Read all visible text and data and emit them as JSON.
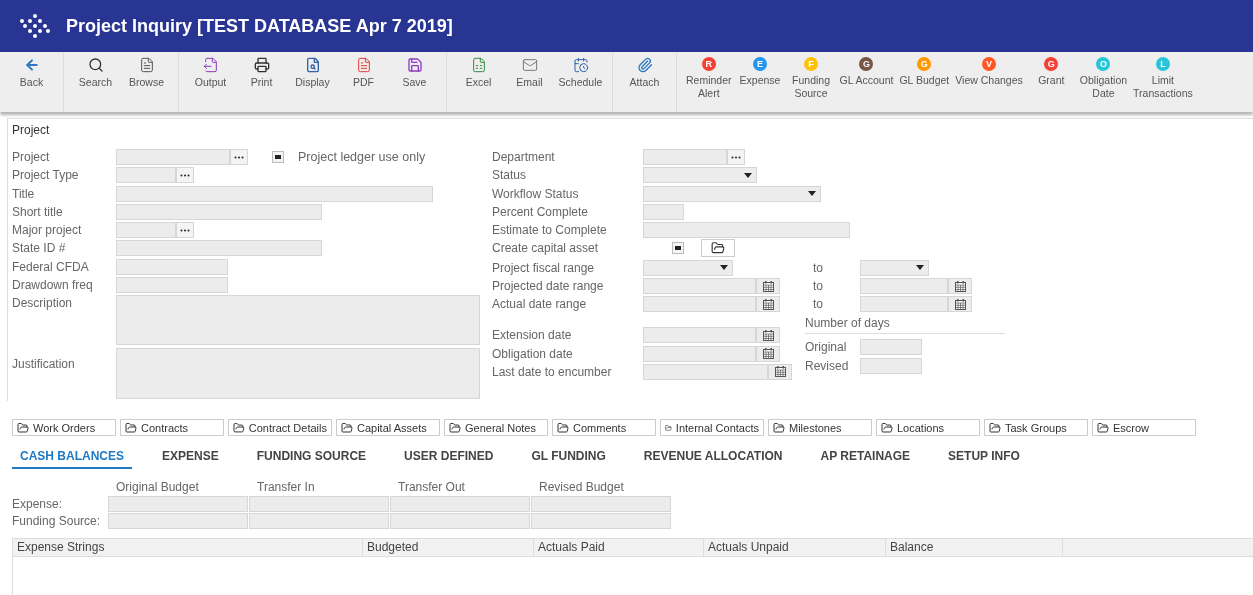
{
  "window": {
    "title": "Project Inquiry [TEST DATABASE Apr 7 2019]"
  },
  "toolbar": {
    "groups": [
      [
        {
          "kind": "icon",
          "label": "Back"
        }
      ],
      [
        {
          "kind": "icon",
          "label": "Search"
        },
        {
          "kind": "icon",
          "label": "Browse"
        }
      ],
      [
        {
          "kind": "icon",
          "label": "Output"
        },
        {
          "kind": "icon",
          "label": "Print"
        },
        {
          "kind": "icon",
          "label": "Display"
        },
        {
          "kind": "icon",
          "label": "PDF"
        },
        {
          "kind": "icon",
          "label": "Save"
        }
      ],
      [
        {
          "kind": "icon",
          "label": "Excel"
        },
        {
          "kind": "icon",
          "label": "Email"
        },
        {
          "kind": "icon",
          "label": "Schedule"
        }
      ],
      [
        {
          "kind": "icon",
          "label": "Attach"
        }
      ],
      [
        {
          "kind": "badge",
          "badge": "R",
          "color": "#f44336",
          "label": "Reminder\nAlert"
        },
        {
          "kind": "badge",
          "badge": "E",
          "color": "#2196f3",
          "label": "Expense"
        },
        {
          "kind": "badge",
          "badge": "F",
          "color": "#ffc107",
          "label": "Funding\nSource"
        },
        {
          "kind": "badge",
          "badge": "G",
          "color": "#795548",
          "label": "GL Account"
        },
        {
          "kind": "badge",
          "badge": "G",
          "color": "#ff9800",
          "label": "GL Budget"
        },
        {
          "kind": "badge",
          "badge": "V",
          "color": "#ff5722",
          "label": "View Changes"
        },
        {
          "kind": "badge",
          "badge": "G",
          "color": "#f44336",
          "label": "Grant"
        },
        {
          "kind": "badge",
          "badge": "O",
          "color": "#26c6da",
          "label": "Obligation\nDate"
        },
        {
          "kind": "badge",
          "badge": "L",
          "color": "#26c6da",
          "label": "Limit\nTransactions"
        }
      ]
    ]
  },
  "section": {
    "title": "Project"
  },
  "left_fields": [
    {
      "kind": "lookup",
      "label": "Project",
      "extra": {
        "label": "Project ledger use only",
        "checked": true
      }
    },
    {
      "kind": "lookup",
      "label": "Project Type"
    },
    {
      "kind": "text",
      "label": "Title"
    },
    {
      "kind": "text",
      "label": "Short title"
    },
    {
      "kind": "lookup",
      "label": "Major project"
    },
    {
      "kind": "text",
      "label": "State ID #"
    },
    {
      "kind": "text",
      "label": "Federal CFDA"
    },
    {
      "kind": "text",
      "label": "Drawdown freq"
    },
    {
      "kind": "textarea",
      "label": "Description"
    },
    {
      "kind": "textarea",
      "label": "Justification"
    }
  ],
  "right_fields": [
    {
      "kind": "lookup",
      "label": "Department"
    },
    {
      "kind": "select",
      "label": "Status"
    },
    {
      "kind": "select",
      "label": "Workflow Status"
    },
    {
      "kind": "text",
      "label": "Percent Complete"
    },
    {
      "kind": "text",
      "label": "Estimate to Complete"
    },
    {
      "kind": "checkbox",
      "label": "Create capital asset",
      "checked": true
    },
    {
      "kind": "select",
      "label": "Project fiscal range",
      "to_label": "to"
    },
    {
      "kind": "date",
      "label": "Projected date range",
      "to_label": "to"
    },
    {
      "kind": "date",
      "label": "Actual date range",
      "to_label": "to"
    }
  ],
  "date_fields": [
    {
      "kind": "date",
      "label": "Extension date"
    },
    {
      "kind": "date",
      "label": "Obligation date"
    },
    {
      "kind": "date",
      "label": "Last date to encumber"
    }
  ],
  "number_of_days": {
    "title": "Number of days",
    "rows": [
      {
        "label": "Original"
      },
      {
        "label": "Revised"
      }
    ]
  },
  "attachments": [
    "Work Orders",
    "Contracts",
    "Contract Details",
    "Capital Assets",
    "General Notes",
    "Comments",
    "Internal Contacts",
    "Milestones",
    "Locations",
    "Task Groups",
    "Escrow"
  ],
  "tabs": [
    {
      "label": "CASH BALANCES",
      "selected": true
    },
    {
      "label": "EXPENSE",
      "selected": false
    },
    {
      "label": "FUNDING SOURCE",
      "selected": false
    },
    {
      "label": "USER DEFINED",
      "selected": false
    },
    {
      "label": "GL FUNDING",
      "selected": false
    },
    {
      "label": "REVENUE ALLOCATION",
      "selected": false
    },
    {
      "label": "AP RETAINAGE",
      "selected": false
    },
    {
      "label": "SETUP INFO",
      "selected": false
    }
  ],
  "balances": {
    "columns": [
      "Original Budget",
      "Transfer In",
      "Transfer Out",
      "Revised Budget"
    ],
    "rows": [
      "Expense:",
      "Funding Source:"
    ]
  },
  "table": {
    "columns": [
      "Expense Strings",
      "Budgeted",
      "Actuals Paid",
      "Actuals Unpaid",
      "Balance"
    ]
  }
}
